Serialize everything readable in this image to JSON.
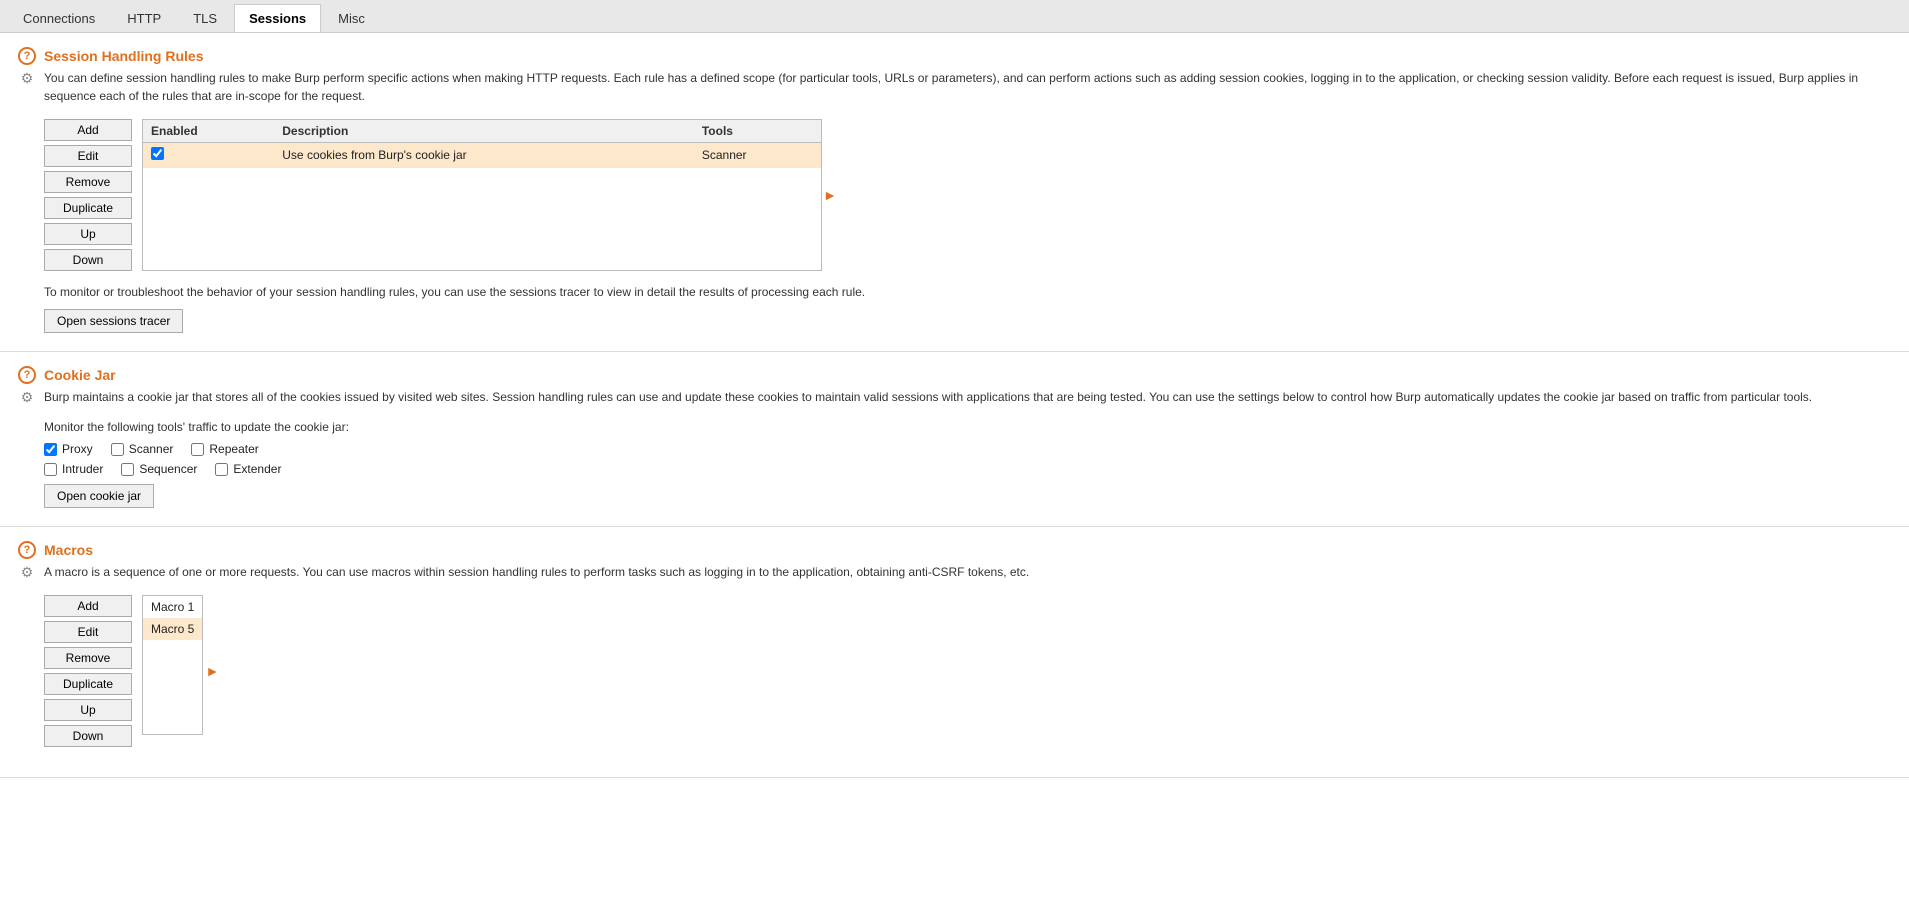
{
  "tabs": [
    {
      "label": "Connections",
      "active": false
    },
    {
      "label": "HTTP",
      "active": false
    },
    {
      "label": "TLS",
      "active": false
    },
    {
      "label": "Sessions",
      "active": true
    },
    {
      "label": "Misc",
      "active": false
    }
  ],
  "session_handling": {
    "title": "Session Handling Rules",
    "description": "You can define session handling rules to make Burp perform specific actions when making HTTP requests. Each rule has a defined scope (for particular tools, URLs or parameters), and can perform actions such as adding session cookies, logging in to the application, or checking session validity. Before each request is issued, Burp applies in sequence each of the rules that are in-scope for the request.",
    "table": {
      "columns": [
        "Enabled",
        "Description",
        "Tools"
      ],
      "rows": [
        {
          "enabled": true,
          "description": "Use cookies from Burp's cookie jar",
          "tools": "Scanner",
          "selected": true
        }
      ]
    },
    "buttons": [
      "Add",
      "Edit",
      "Remove",
      "Duplicate",
      "Up",
      "Down"
    ],
    "tracer_desc": "To monitor or troubleshoot the behavior of your session handling rules, you can use the sessions tracer to view in detail the results of processing each rule.",
    "tracer_button": "Open sessions tracer"
  },
  "cookie_jar": {
    "title": "Cookie Jar",
    "description": "Burp maintains a cookie jar that stores all of the cookies issued by visited web sites. Session handling rules can use and update these cookies to maintain valid sessions with applications that are being tested. You can use the settings below to control how Burp automatically updates the cookie jar based on traffic from particular tools.",
    "monitor_text": "Monitor the following tools' traffic to update the cookie jar:",
    "checkboxes": [
      {
        "label": "Proxy",
        "checked": true
      },
      {
        "label": "Scanner",
        "checked": false
      },
      {
        "label": "Repeater",
        "checked": false
      },
      {
        "label": "Intruder",
        "checked": false
      },
      {
        "label": "Sequencer",
        "checked": false
      },
      {
        "label": "Extender",
        "checked": false
      }
    ],
    "open_button": "Open cookie jar"
  },
  "macros": {
    "title": "Macros",
    "description": "A macro is a sequence of one or more requests. You can use macros within session handling rules to perform tasks such as logging in to the application, obtaining anti-CSRF tokens, etc.",
    "buttons": [
      "Add",
      "Edit",
      "Remove",
      "Duplicate",
      "Up",
      "Down"
    ],
    "items": [
      {
        "label": "Macro 1",
        "selected": false
      },
      {
        "label": "Macro 5",
        "selected": true
      }
    ]
  }
}
